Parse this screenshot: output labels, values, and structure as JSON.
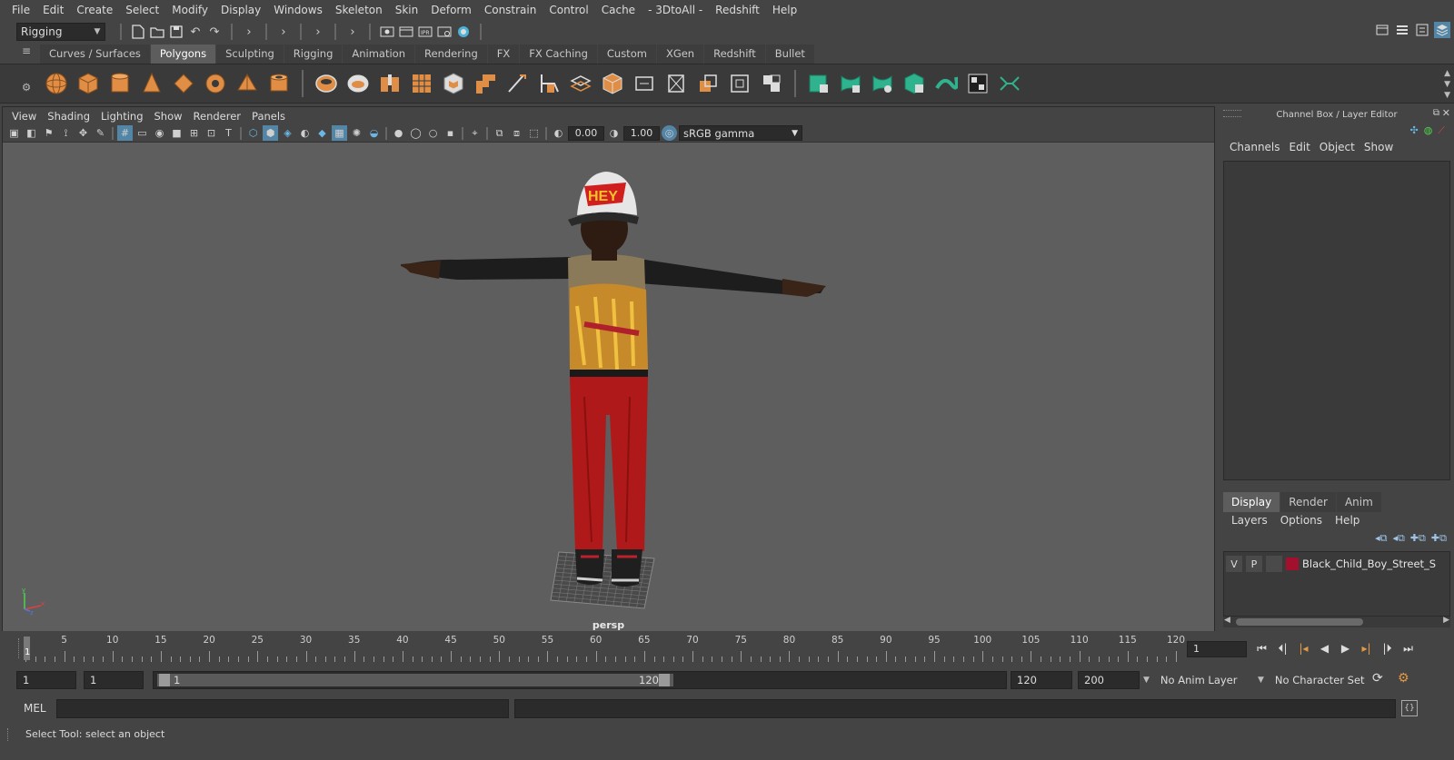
{
  "menubar": [
    "File",
    "Edit",
    "Create",
    "Select",
    "Modify",
    "Display",
    "Windows",
    "Skeleton",
    "Skin",
    "Deform",
    "Constrain",
    "Control",
    "Cache",
    "- 3DtoAll -",
    "Redshift",
    "Help"
  ],
  "mode": "Rigging",
  "shelf": {
    "tabs": [
      "Curves / Surfaces",
      "Polygons",
      "Sculpting",
      "Rigging",
      "Animation",
      "Rendering",
      "FX",
      "FX Caching",
      "Custom",
      "XGen",
      "Redshift",
      "Bullet"
    ],
    "active": "Polygons"
  },
  "viewport": {
    "menu": [
      "View",
      "Shading",
      "Lighting",
      "Show",
      "Renderer",
      "Panels"
    ],
    "exposure": "0.00",
    "gamma_value": "1.00",
    "color_space": "sRGB gamma",
    "camera": "persp",
    "axis": {
      "x": "x",
      "y": "y",
      "z": "z"
    },
    "model": {
      "cap_text": "HEY"
    }
  },
  "channel_box": {
    "title": "Channel Box / Layer Editor",
    "menu": [
      "Channels",
      "Edit",
      "Object",
      "Show"
    ]
  },
  "layer_editor": {
    "tabs": [
      "Display",
      "Render",
      "Anim"
    ],
    "active": "Display",
    "menu": [
      "Layers",
      "Options",
      "Help"
    ],
    "layer": {
      "v": "V",
      "p": "P",
      "name": "Black_Child_Boy_Street_S",
      "color": "#a3102e"
    }
  },
  "timeline": {
    "ticks": [
      1,
      5,
      10,
      15,
      20,
      25,
      30,
      35,
      40,
      45,
      50,
      55,
      60,
      65,
      70,
      75,
      80,
      85,
      90,
      95,
      100,
      105,
      110,
      115,
      120
    ],
    "start": 1,
    "end": 120,
    "current": 1,
    "current_frame_field": "1"
  },
  "range": {
    "start_field": "1",
    "anim_start_field": "1",
    "bar_start": "1",
    "bar_end": "120",
    "end_field": "120",
    "anim_end_field": "200",
    "anim_layer": "No Anim Layer",
    "char_set": "No Character Set"
  },
  "cmdline": {
    "lang": "MEL"
  },
  "help_text": "Select Tool: select an object"
}
